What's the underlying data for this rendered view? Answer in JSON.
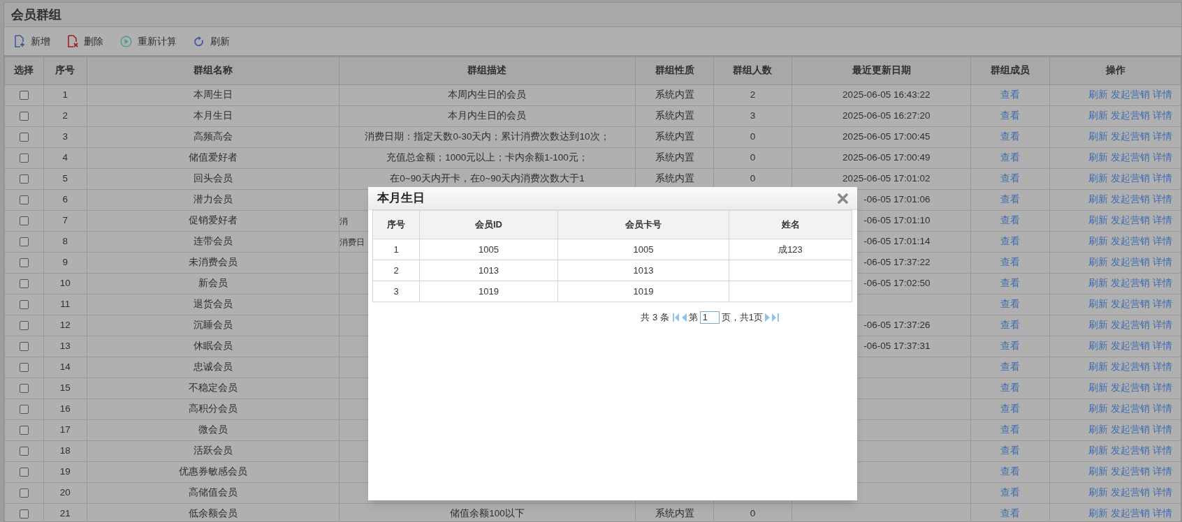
{
  "page_title": "会员群组",
  "toolbar": [
    {
      "kind": "add",
      "label": "新增"
    },
    {
      "kind": "delete",
      "label": "删除"
    },
    {
      "kind": "recalc",
      "label": "重新计算"
    },
    {
      "kind": "refresh",
      "label": "刷新"
    }
  ],
  "table": {
    "columns": [
      "选择",
      "序号",
      "群组名称",
      "群组描述",
      "群组性质",
      "群组人数",
      "最近更新日期",
      "群组成员",
      "操作"
    ],
    "rows": [
      {
        "checked": false,
        "index": "1",
        "name": "本周生日",
        "description": "本周内生日的会员",
        "type": "系统内置",
        "count": "2",
        "updated": "2025-06-05 16:43:22",
        "members": "查看",
        "actions": [
          "刷新",
          "发起营销",
          "详情"
        ]
      },
      {
        "checked": false,
        "index": "2",
        "name": "本月生日",
        "description": "本月内生日的会员",
        "type": "系统内置",
        "count": "3",
        "updated": "2025-06-05 16:27:20",
        "members": "查看",
        "actions": [
          "刷新",
          "发起营销",
          "详情"
        ]
      },
      {
        "checked": false,
        "index": "3",
        "name": "高频高会",
        "description": "消费日期：指定天数0-30天内；累计消费次数达到10次；",
        "type": "系统内置",
        "count": "0",
        "updated": "2025-06-05 17:00:45",
        "members": "查看",
        "actions": [
          "刷新",
          "发起营销",
          "详情"
        ]
      },
      {
        "checked": false,
        "index": "4",
        "name": "储值爱好者",
        "description": "充值总金额；1000元以上；卡内余额1-100元；",
        "type": "系统内置",
        "count": "0",
        "updated": "2025-06-05 17:00:49",
        "members": "查看",
        "actions": [
          "刷新",
          "发起营销",
          "详情"
        ]
      },
      {
        "checked": false,
        "index": "5",
        "name": "回头会员",
        "description": "在0~90天内开卡，在0~90天内消费次数大于1",
        "type": "系统内置",
        "count": "0",
        "updated": "2025-06-05 17:01:02",
        "members": "查看",
        "actions": [
          "刷新",
          "发起营销",
          "详情"
        ]
      },
      {
        "checked": false,
        "index": "6",
        "name": "潜力会员",
        "updated": "-06-05 17:01:06",
        "members": "查看",
        "actions": [
          "刷新",
          "发起营销",
          "详情"
        ]
      },
      {
        "checked": false,
        "index": "7",
        "name": "促销爱好者",
        "description": "消",
        "updated": "-06-05 17:01:10",
        "members": "查看",
        "actions": [
          "刷新",
          "发起营销",
          "详情"
        ]
      },
      {
        "checked": false,
        "index": "8",
        "name": "连带会员",
        "description": "消费日",
        "updated": "-06-05 17:01:14",
        "members": "查看",
        "actions": [
          "刷新",
          "发起营销",
          "详情"
        ]
      },
      {
        "checked": false,
        "index": "9",
        "name": "未消费会员",
        "updated": "-06-05 17:37:22",
        "members": "查看",
        "actions": [
          "刷新",
          "发起营销",
          "详情"
        ]
      },
      {
        "checked": false,
        "index": "10",
        "name": "新会员",
        "updated": "-06-05 17:02:50",
        "members": "查看",
        "actions": [
          "刷新",
          "发起营销",
          "详情"
        ]
      },
      {
        "checked": false,
        "index": "11",
        "name": "退货会员",
        "members": "查看",
        "actions": [
          "刷新",
          "发起营销",
          "详情"
        ]
      },
      {
        "checked": false,
        "index": "12",
        "name": "沉睡会员",
        "updated": "-06-05 17:37:26",
        "members": "查看",
        "actions": [
          "刷新",
          "发起营销",
          "详情"
        ]
      },
      {
        "checked": false,
        "index": "13",
        "name": "休眠会员",
        "updated": "-06-05 17:37:31",
        "members": "查看",
        "actions": [
          "刷新",
          "发起营销",
          "详情"
        ]
      },
      {
        "checked": false,
        "index": "14",
        "name": "忠诚会员",
        "members": "查看",
        "actions": [
          "刷新",
          "发起营销",
          "详情"
        ]
      },
      {
        "checked": false,
        "index": "15",
        "name": "不稳定会员",
        "members": "查看",
        "actions": [
          "刷新",
          "发起营销",
          "详情"
        ]
      },
      {
        "checked": false,
        "index": "16",
        "name": "高积分会员",
        "members": "查看",
        "actions": [
          "刷新",
          "发起营销",
          "详情"
        ]
      },
      {
        "checked": false,
        "index": "17",
        "name": "微会员",
        "members": "查看",
        "actions": [
          "刷新",
          "发起营销",
          "详情"
        ]
      },
      {
        "checked": false,
        "index": "18",
        "name": "活跃会员",
        "members": "查看",
        "actions": [
          "刷新",
          "发起营销",
          "详情"
        ]
      },
      {
        "checked": false,
        "index": "19",
        "name": "优惠券敏感会员",
        "members": "查看",
        "actions": [
          "刷新",
          "发起营销",
          "详情"
        ]
      },
      {
        "checked": false,
        "index": "20",
        "name": "高储值会员",
        "members": "查看",
        "actions": [
          "刷新",
          "发起营销",
          "详情"
        ]
      },
      {
        "checked": false,
        "index": "21",
        "name": "低余额会员",
        "description": "储值余额100以下",
        "type": "系统内置",
        "count": "0",
        "members": "查看",
        "actions": [
          "刷新",
          "发起营销",
          "详情"
        ]
      }
    ]
  },
  "dialog": {
    "title": "本月生日",
    "columns": [
      "序号",
      "会员ID",
      "会员卡号",
      "姓名"
    ],
    "rows": [
      [
        "1",
        "1005",
        "1005",
        "成123"
      ],
      [
        "2",
        "1013",
        "1013",
        ""
      ],
      [
        "3",
        "1019",
        "1019",
        ""
      ]
    ],
    "pager": {
      "total": "共 3 条",
      "page_prefix": "第",
      "page_value": "1",
      "page_suffix": "页，共1页"
    }
  }
}
